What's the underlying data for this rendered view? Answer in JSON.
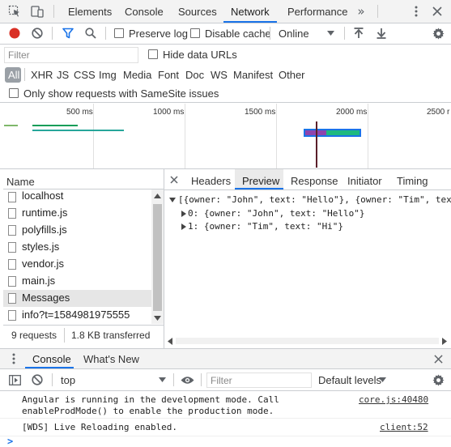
{
  "top_tabs": {
    "elements": "Elements",
    "console": "Console",
    "sources": "Sources",
    "network": "Network",
    "performance": "Performance"
  },
  "toolbar": {
    "preserve_log": "Preserve log",
    "disable_cache": "Disable cache",
    "throttle": "Online"
  },
  "filter": {
    "placeholder": "Filter",
    "hide_data_urls": "Hide data URLs"
  },
  "types": [
    "All",
    "XHR",
    "JS",
    "CSS",
    "Img",
    "Media",
    "Font",
    "Doc",
    "WS",
    "Manifest",
    "Other"
  ],
  "samesite": "Only show requests with SameSite issues",
  "timeline": {
    "ticks": [
      "500 ms",
      "1000 ms",
      "1500 ms",
      "2000 ms",
      "2500 r"
    ]
  },
  "requests": {
    "header": "Name",
    "items": [
      "localhost",
      "runtime.js",
      "polyfills.js",
      "styles.js",
      "vendor.js",
      "main.js",
      "Messages",
      "info?t=1584981975555"
    ],
    "status_count": "9 requests",
    "status_transferred": "1.8 KB transferred"
  },
  "detail_tabs": {
    "headers": "Headers",
    "preview": "Preview",
    "response": "Response",
    "initiator": "Initiator",
    "timing": "Timing"
  },
  "preview": {
    "root": "[{owner: \"John\", text: \"Hello\"}, {owner: \"Tim\", tex",
    "item0": "0: {owner: \"John\", text: \"Hello\"}",
    "item1": "1: {owner: \"Tim\", text: \"Hi\"}"
  },
  "drawer_tabs": {
    "console": "Console",
    "whats_new": "What's New"
  },
  "console_toolbar": {
    "context": "top",
    "filter_placeholder": "Filter",
    "levels": "Default levels"
  },
  "console_messages": [
    {
      "text": "Angular is running in the development mode. Call\nenableProdMode() to enable the production mode.",
      "source": "core.js:40480"
    },
    {
      "text": "[WDS] Live Reloading enabled.",
      "source": "client:52"
    }
  ],
  "prompt": ">",
  "colors": {
    "accent": "#1a73e8",
    "record": "#d93025",
    "selected_row": "#e6e6e6"
  }
}
